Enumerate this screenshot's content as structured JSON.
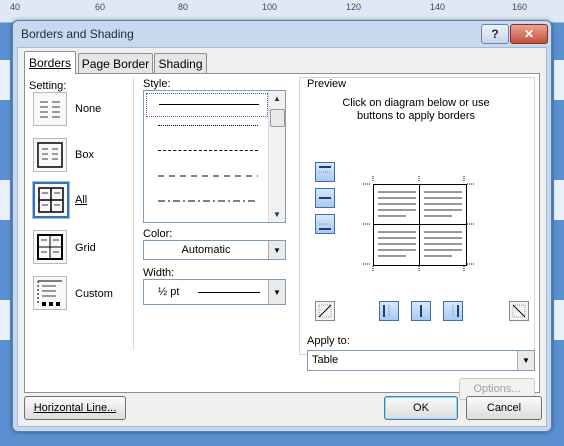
{
  "ruler": {
    "marks": [
      "40",
      "60",
      "80",
      "100",
      "120",
      "140",
      "160"
    ]
  },
  "dialog": {
    "title": "Borders and Shading",
    "help_label": "?",
    "close_label": "✕",
    "tabs": [
      {
        "label": "Borders",
        "active": true
      },
      {
        "label": "Page Border",
        "active": false
      },
      {
        "label": "Shading",
        "active": false
      }
    ],
    "setting": {
      "heading": "Setting:",
      "options": [
        {
          "label": "None",
          "selected": false
        },
        {
          "label": "Box",
          "selected": false
        },
        {
          "label": "All",
          "selected": true
        },
        {
          "label": "Grid",
          "selected": false
        },
        {
          "label": "Custom",
          "selected": false
        }
      ]
    },
    "style": {
      "heading": "Style:",
      "items": [
        "solid",
        "dotted",
        "dash-small",
        "dash-large",
        "dash-dot"
      ],
      "selected": "solid"
    },
    "color": {
      "heading": "Color:",
      "value": "Automatic"
    },
    "width": {
      "heading": "Width:",
      "value": "½ pt"
    },
    "preview": {
      "heading": "Preview",
      "instructions_line1": "Click on diagram below or use",
      "instructions_line2": "buttons to apply borders"
    },
    "apply_to": {
      "heading": "Apply to:",
      "value": "Table"
    },
    "buttons": {
      "options": "Options...",
      "horizontal_line": "Horizontal Line...",
      "ok": "OK",
      "cancel": "Cancel"
    },
    "colors": {
      "accent": "#3a6fb8",
      "title_bg": "#c7d9ef",
      "close": "#c44f3a"
    }
  }
}
